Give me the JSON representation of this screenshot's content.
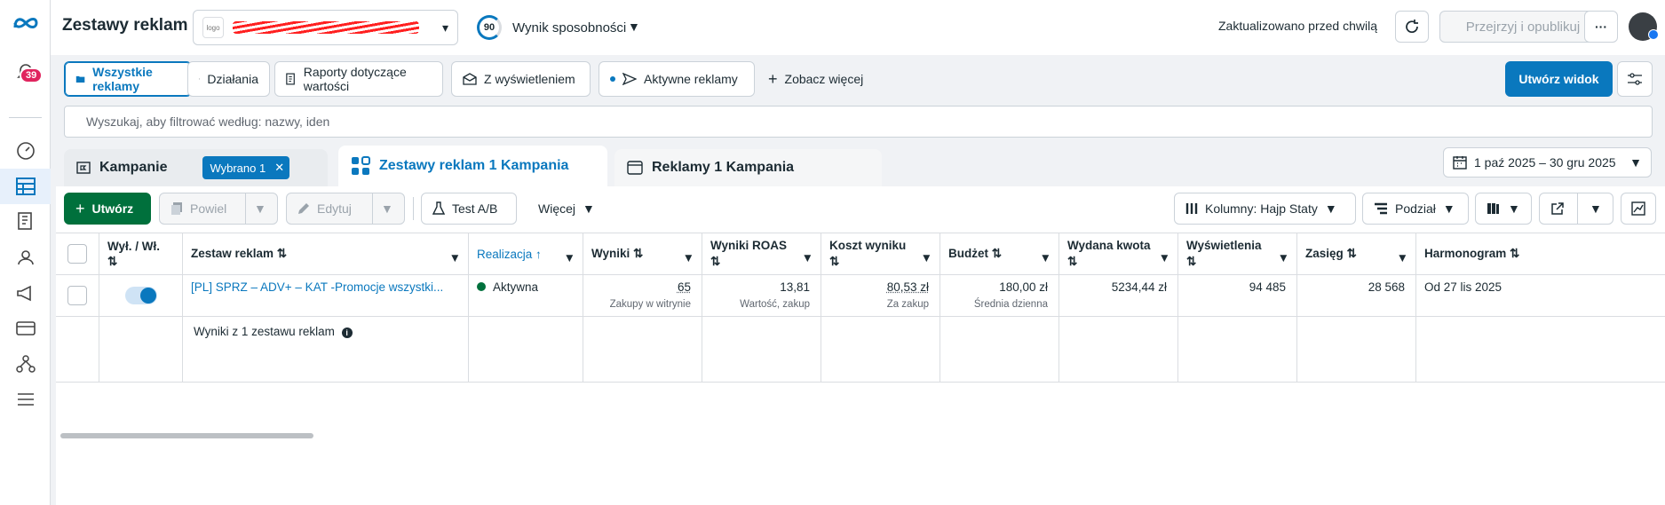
{
  "page": {
    "title": "Zestawy reklam"
  },
  "rail": {
    "notification_count": "39"
  },
  "header": {
    "account_logo_text": "logo",
    "opportunity_score": "90",
    "opportunity_label": "Wynik sposobności",
    "updated_text": "Zaktualizowano przed chwilą",
    "review_label": "Przejrzyj i opublikuj",
    "more_label": "···"
  },
  "views": {
    "all_ads": "Wszystkie reklamy",
    "actions": "Działania",
    "value_reports": "Raporty dotyczące wartości",
    "with_impressions": "Z wyświetleniem",
    "active_ads": "Aktywne reklamy",
    "see_more": "Zobacz więcej",
    "create_view": "Utwórz widok"
  },
  "search": {
    "placeholder": "Wyszukaj, aby filtrować według: nazwy, iden"
  },
  "level_tabs": {
    "campaigns": "Kampanie",
    "selected_chip": "Wybrano 1",
    "adsets": "Zestawy reklam 1 Kampania",
    "ads": "Reklamy 1 Kampania"
  },
  "date_range": "1 paź 2025 – 30 gru 2025",
  "toolbar": {
    "create": "Utwórz",
    "duplicate": "Powiel",
    "edit": "Edytuj",
    "ab_test": "Test A/B",
    "more": "Więcej",
    "columns": "Kolumny: Hajp Staty",
    "breakdown": "Podział"
  },
  "table": {
    "headers": {
      "onoff": "Wył. / Wł. ⇅",
      "adset": "Zestaw reklam ⇅",
      "delivery": "Realizacja ↑",
      "results": "Wyniki ⇅",
      "roas": "Wyniki ROAS ⇅",
      "cpr": "Koszt wyniku ⇅",
      "budget": "Budżet ⇅",
      "spent": "Wydana kwota ⇅",
      "impressions": "Wyświetlenia ⇅",
      "reach": "Zasięg ⇅",
      "schedule": "Harmonogram ⇅"
    },
    "row": {
      "adset_name": "[PL] SPRZ – ADV+ – KAT -Promocje wszystki...",
      "delivery": "Aktywna",
      "results": "65",
      "results_sub": "Zakupy w witrynie",
      "roas": "13,81",
      "roas_sub": "Wartość, zakup",
      "cpr": "80,53 zł",
      "cpr_sub": "Za zakup",
      "budget": "180,00 zł",
      "budget_sub": "Średnia dzienna",
      "spent": "5234,44 zł",
      "impressions": "94 485",
      "reach": "28 568",
      "schedule": "Od 27 lis 2025"
    },
    "summary": "Wyniki z 1 zestawu reklam"
  },
  "colors": {
    "accent": "#0a78be",
    "create_green": "#00703c",
    "status_active": "#00703c",
    "badge_red": "#e0245e"
  }
}
